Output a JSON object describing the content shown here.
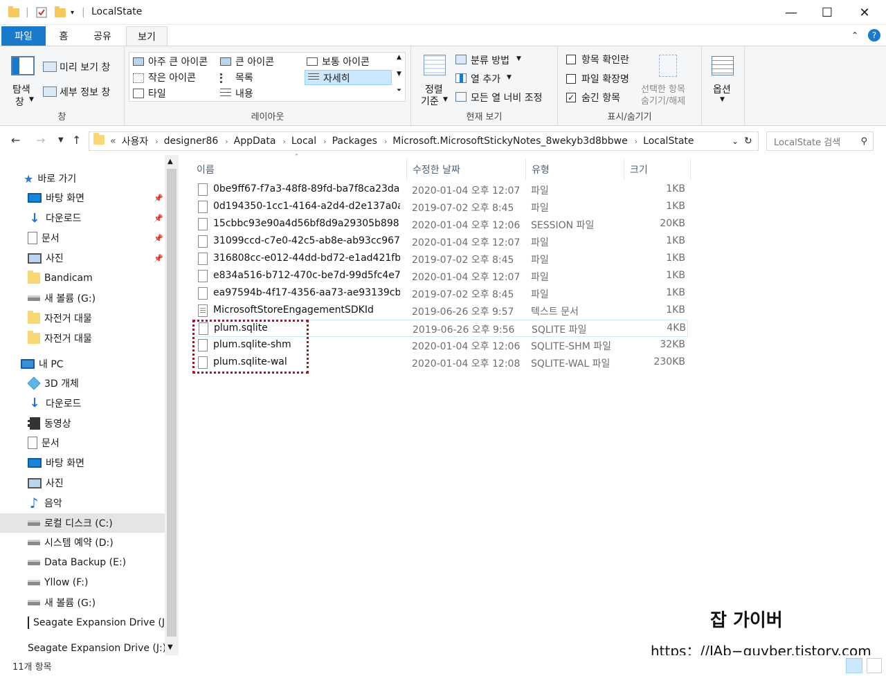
{
  "window": {
    "title": "LocalState",
    "controls": {
      "minimize": "—",
      "maximize": "☐",
      "close": "✕"
    }
  },
  "tabs": [
    {
      "label": "파일"
    },
    {
      "label": "홈"
    },
    {
      "label": "공유"
    },
    {
      "label": "보기"
    }
  ],
  "ribbon": {
    "pane": {
      "nav_pane_label": "탐색",
      "nav_pane_label2": "창",
      "preview_label": "미리 보기 창",
      "details_label": "세부 정보 창",
      "group_label": "창"
    },
    "layout": {
      "items": [
        "아주 큰 아이콘",
        "큰 아이콘",
        "보통 아이콘",
        "작은 아이콘",
        "목록",
        "자세히",
        "타일",
        "내용"
      ],
      "selected": "자세히",
      "group_label": "레이아웃"
    },
    "current_view": {
      "sort_label": "정렬",
      "sort_label2": "기준",
      "group_by": "분류 방법",
      "add_column": "열 추가",
      "fit_columns": "모든 열 너비 조정",
      "group_label": "현재 보기"
    },
    "show_hide": {
      "item_checkboxes": "항목 확인란",
      "file_extensions": "파일 확장명",
      "hidden_items": "숨긴 항목",
      "hide_selected": "선택한 항목",
      "hide_selected2": "숨기기/해제",
      "group_label": "표시/숨기기"
    },
    "options": {
      "label": "옵션"
    }
  },
  "address": {
    "prefix": "«",
    "crumbs": [
      "사용자",
      "designer86",
      "AppData",
      "Local",
      "Packages",
      "Microsoft.MicrosoftStickyNotes_8wekyb3d8bbwe",
      "LocalState"
    ],
    "search_placeholder": "LocalState 검색"
  },
  "nav_pane": {
    "quick_access_label": "바로 가기",
    "quick_access": [
      {
        "label": "바탕 화면",
        "icon": "desktop-icon",
        "pinned": true
      },
      {
        "label": "다운로드",
        "icon": "download-icon",
        "pinned": true
      },
      {
        "label": "문서",
        "icon": "document-icon",
        "pinned": true
      },
      {
        "label": "사진",
        "icon": "picture-icon",
        "pinned": true
      },
      {
        "label": "Bandicam",
        "icon": "folder-icon",
        "pinned": false
      },
      {
        "label": "새 볼륨 (G:)",
        "icon": "drive-icon",
        "pinned": false
      },
      {
        "label": "자전거 대물",
        "icon": "folder-icon",
        "pinned": false
      },
      {
        "label": "자전거 대물",
        "icon": "folder-icon",
        "pinned": false
      }
    ],
    "this_pc_label": "내 PC",
    "this_pc": [
      {
        "label": "3D 개체",
        "icon": "3d-objects-icon"
      },
      {
        "label": "다운로드",
        "icon": "download-icon"
      },
      {
        "label": "동영상",
        "icon": "video-icon"
      },
      {
        "label": "문서",
        "icon": "document-icon"
      },
      {
        "label": "바탕 화면",
        "icon": "desktop-icon"
      },
      {
        "label": "사진",
        "icon": "picture-icon"
      },
      {
        "label": "음악",
        "icon": "music-icon"
      },
      {
        "label": "로컬 디스크 (C:)",
        "icon": "drive-icon"
      },
      {
        "label": "시스템 예약 (D:)",
        "icon": "drive-icon"
      },
      {
        "label": "Data Backup (E:)",
        "icon": "drive-icon"
      },
      {
        "label": "Yllow (F:)",
        "icon": "drive-icon"
      },
      {
        "label": "새 볼륨 (G:)",
        "icon": "drive-icon"
      },
      {
        "label": "Seagate Expansion Drive (J",
        "icon": "external-drive-icon"
      }
    ],
    "selected": "로컬 디스크 (C:)",
    "last_item": "Seagate Expansion Drive (J:)"
  },
  "file_list": {
    "columns": {
      "name": "이름",
      "date": "수정한 날짜",
      "type": "유형",
      "size": "크기"
    },
    "files": [
      {
        "name": "0be9ff67-f7a3-48f8-89fd-ba7f8ca23da4",
        "date": "2020-01-04 오후 12:07",
        "type": "파일",
        "size": "1KB"
      },
      {
        "name": "0d194350-1cc1-4164-a2d4-d2e137a0a...",
        "date": "2019-07-02 오후 8:45",
        "type": "파일",
        "size": "1KB"
      },
      {
        "name": "15cbbc93e90a4d56bf8d9a29305b8981...",
        "date": "2020-01-04 오후 12:06",
        "type": "SESSION 파일",
        "size": "20KB"
      },
      {
        "name": "31099ccd-c7e0-42c5-ab8e-ab93cc967...",
        "date": "2020-01-04 오후 12:07",
        "type": "파일",
        "size": "1KB"
      },
      {
        "name": "316808cc-e012-44dd-bd72-e1ad421fb...",
        "date": "2019-07-02 오후 8:45",
        "type": "파일",
        "size": "1KB"
      },
      {
        "name": "e834a516-b712-470c-be7d-99d5fc4e7...",
        "date": "2020-01-04 오후 12:07",
        "type": "파일",
        "size": "1KB"
      },
      {
        "name": "ea97594b-4f17-4356-aa73-ae93139cb...",
        "date": "2019-07-02 오후 8:45",
        "type": "파일",
        "size": "1KB"
      },
      {
        "name": "MicrosoftStoreEngagementSDKId",
        "date": "2019-06-26 오후 9:57",
        "type": "텍스트 문서",
        "size": "1KB"
      },
      {
        "name": "plum.sqlite",
        "date": "2019-06-26 오후 9:56",
        "type": "SQLITE 파일",
        "size": "4KB"
      },
      {
        "name": "plum.sqlite-shm",
        "date": "2020-01-04 오후 12:06",
        "type": "SQLITE-SHM 파일",
        "size": "32KB"
      },
      {
        "name": "plum.sqlite-wal",
        "date": "2020-01-04 오후 12:08",
        "type": "SQLITE-WAL 파일",
        "size": "230KB"
      }
    ]
  },
  "status": {
    "count": "11개 항목"
  },
  "watermark": {
    "title": "잡 가이버",
    "url": "https：//JAb−guyber.tistory.com"
  },
  "colors": {
    "accent": "#1979ca",
    "highlight_box": "#b3101e"
  }
}
